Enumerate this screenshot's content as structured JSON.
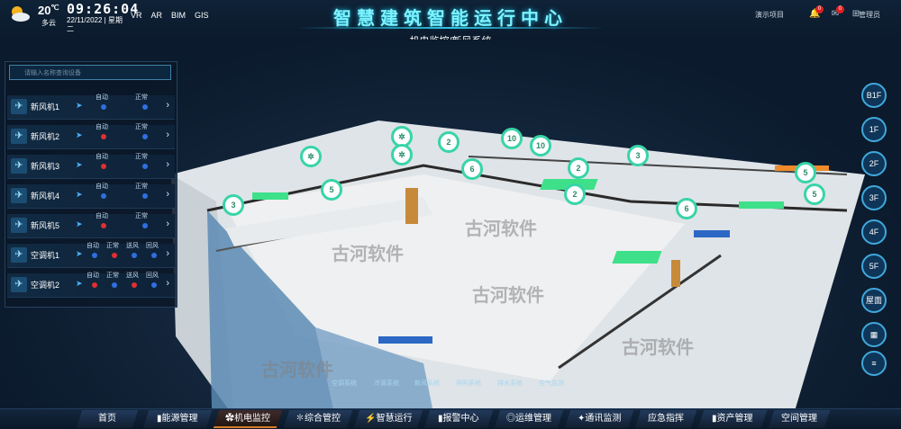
{
  "header": {
    "temperature": "20",
    "temperature_unit": "℃",
    "weather": "多云",
    "time": "09:26:04",
    "date": "22/11/2022 | 星期",
    "weekday": "二",
    "nav": [
      "VR",
      "AR",
      "BIM",
      "GIS"
    ],
    "title": "智慧建筑智能运行中心",
    "subtitle": "机电监控/新风系统",
    "project": "演示项目",
    "alerts_count": "0",
    "messages_count": "0",
    "user": "管理员"
  },
  "search": {
    "placeholder": "请输入名称查询设备"
  },
  "devices": [
    {
      "name": "新风机1",
      "labels": [
        "自动",
        "正常"
      ],
      "dots": [
        "#2f6fe0",
        "#2f6fe0"
      ]
    },
    {
      "name": "新风机2",
      "labels": [
        "自动",
        "正常"
      ],
      "dots": [
        "#e03030",
        "#2f6fe0"
      ]
    },
    {
      "name": "新风机3",
      "labels": [
        "自动",
        "正常"
      ],
      "dots": [
        "#e03030",
        "#2f6fe0"
      ]
    },
    {
      "name": "新风机4",
      "labels": [
        "自动",
        "正常"
      ],
      "dots": [
        "#2f6fe0",
        "#2f6fe0"
      ]
    },
    {
      "name": "新风机5",
      "labels": [
        "自动",
        "正常"
      ],
      "dots": [
        "#e03030",
        "#2f6fe0"
      ]
    },
    {
      "name": "空调机1",
      "labels": [
        "自动",
        "正常",
        "送风",
        "回风"
      ],
      "dots": [
        "#2f6fe0",
        "#e03030",
        "#2f6fe0",
        "#2f6fe0"
      ]
    },
    {
      "name": "空调机2",
      "labels": [
        "自动",
        "正常",
        "送风",
        "回风"
      ],
      "dots": [
        "#e03030",
        "#2f6fe0",
        "#e03030",
        "#2f6fe0"
      ]
    }
  ],
  "floors": [
    "B1F",
    "1F",
    "2F",
    "3F",
    "4F",
    "5F",
    "屋面",
    "",
    ""
  ],
  "legend": [
    "空调系统",
    "冷源系统",
    "新风系统",
    "照明系统",
    "排水系统",
    "空气监测"
  ],
  "markers": [
    "2",
    "10",
    "10",
    "3",
    "6",
    "2",
    "2",
    "5",
    "5",
    "5",
    "3",
    "6"
  ],
  "watermark": "古河软件",
  "tabs": [
    "首页",
    "能源管理",
    "机电监控",
    "综合管控",
    "智慧运行",
    "报警中心",
    "运维管理",
    "通讯监测",
    "应急指挥",
    "资产管理",
    "空间管理"
  ],
  "active_tab": "机电监控",
  "colors": {
    "accent": "#38d4a8",
    "title": "#7df3ff",
    "alarm": "#e03030",
    "ok": "#2f6fe0"
  }
}
